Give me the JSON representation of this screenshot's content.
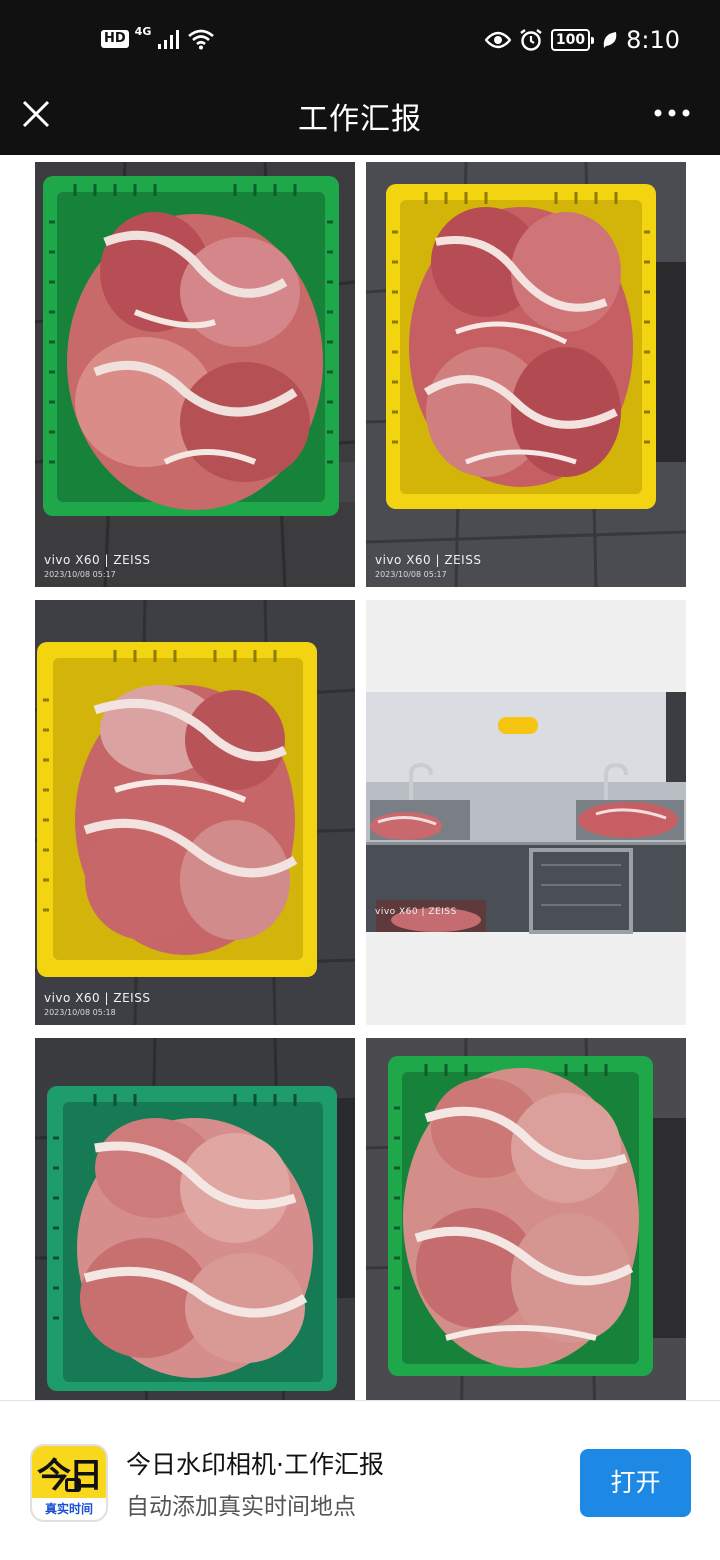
{
  "status_bar": {
    "hd_label": "HD",
    "network_label": "4G",
    "battery_level": "100",
    "time": "8:10",
    "icons": [
      "signal-icon",
      "wifi-icon",
      "eye-icon",
      "alarm-icon",
      "battery-icon",
      "leaf-icon"
    ]
  },
  "nav": {
    "title": "工作汇报",
    "close_icon": "close-icon",
    "more_icon": "more-dots-icon"
  },
  "photos": [
    {
      "crate_color": "#1fa84a",
      "watermark_model": "vivo X60 | ZEISS",
      "watermark_time": "2023/10/08 05:17"
    },
    {
      "crate_color": "#f2d411",
      "watermark_model": "vivo X60 | ZEISS",
      "watermark_time": "2023/10/08 05:17"
    },
    {
      "crate_color": "#f2d411",
      "watermark_model": "vivo X60 | ZEISS",
      "watermark_time": "2023/10/08 05:18"
    },
    {
      "scene": "kitchen-sink",
      "watermark_model": "vivo X60 | ZEISS",
      "watermark_time": ""
    },
    {
      "crate_color": "#1e9c6c",
      "watermark_model": "",
      "watermark_time": ""
    },
    {
      "crate_color": "#1fa84a",
      "watermark_model": "",
      "watermark_time": ""
    }
  ],
  "banner": {
    "app_icon_big": "今日",
    "app_icon_small": "真实时间",
    "title": "今日水印相机·工作汇报",
    "subtitle": "自动添加真实时间地点",
    "open_button": "打开",
    "button_color": "#1e88e5"
  }
}
